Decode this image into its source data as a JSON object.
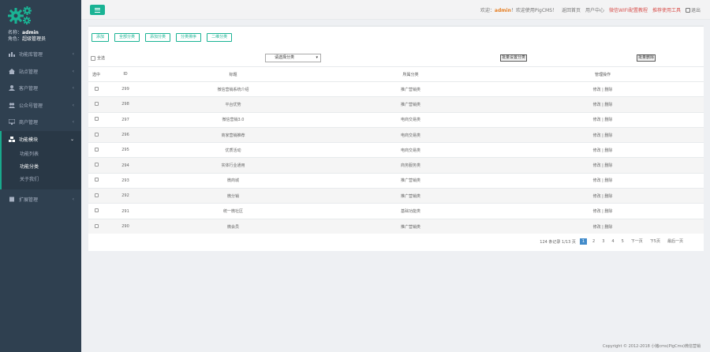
{
  "sidebar": {
    "name_label": "名称：",
    "name_value": "admin",
    "role_label": "角色：",
    "role_value": "超级管理员",
    "items": [
      {
        "label": "功能库管理",
        "active": false
      },
      {
        "label": "站点管理",
        "active": false
      },
      {
        "label": "客户管理",
        "active": false
      },
      {
        "label": "公众号管理",
        "active": false
      },
      {
        "label": "商户管理",
        "active": false
      },
      {
        "label": "功能模块",
        "active": true
      },
      {
        "label": "扩展管理",
        "active": false
      }
    ],
    "subitems": [
      {
        "label": "功能列表",
        "active": false
      },
      {
        "label": "功能分类",
        "active": true
      },
      {
        "label": "关于我们",
        "active": false
      }
    ]
  },
  "topbar": {
    "welcome_prefix": "欢迎",
    "user": "admin",
    "welcome_suffix": "！欢迎使用PigCMS！",
    "back_home": "返回首页",
    "user_center": "用户中心",
    "red_link1": "微信WIFI配置教程",
    "red_link2": "推荐使用工具",
    "logout": "退出"
  },
  "toolbar": [
    "添加",
    "全部分类",
    "添加分类",
    "分类排序",
    "二维分类"
  ],
  "filter": {
    "select_all": "全选",
    "select_value": "请选择分类",
    "btn_batch": "批量设置分类",
    "btn_delete": "批量删除"
  },
  "table": {
    "headers": [
      "选中",
      "ID",
      "标题",
      "所属分类",
      "管理操作"
    ],
    "rows": [
      {
        "id": "299",
        "title": "微信营销系统介绍",
        "cat": "推广营销类",
        "op": "修改 | 删除"
      },
      {
        "id": "298",
        "title": "平台优势",
        "cat": "推广营销类",
        "op": "修改 | 删除"
      },
      {
        "id": "297",
        "title": "微信营销3.0",
        "cat": "电商交易类",
        "op": "修改 | 删除"
      },
      {
        "id": "296",
        "title": "商家营销推荐",
        "cat": "电商交易类",
        "op": "修改 | 删除"
      },
      {
        "id": "295",
        "title": "优质活动",
        "cat": "电商交易类",
        "op": "修改 | 删除"
      },
      {
        "id": "294",
        "title": "实体行业通用",
        "cat": "商务服务类",
        "op": "修改 | 删除"
      },
      {
        "id": "293",
        "title": "微商城",
        "cat": "推广营销类",
        "op": "修改 | 删除"
      },
      {
        "id": "292",
        "title": "微分销",
        "cat": "推广营销类",
        "op": "修改 | 删除"
      },
      {
        "id": "291",
        "title": "统一微社区",
        "cat": "基础功能类",
        "op": "修改 | 删除"
      },
      {
        "id": "290",
        "title": "微会员",
        "cat": "推广营销类",
        "op": "修改 | 删除"
      }
    ]
  },
  "pager": {
    "summary": "124 条记录 1/13 页",
    "pages": [
      "1",
      "2",
      "3",
      "4",
      "5"
    ],
    "next": "下一页",
    "next5": "下5页",
    "last": "最后一页"
  },
  "footer": "Copyright © 2012-2018 小猪cms(PigCms)微信营销",
  "colors": {
    "accent": "#1ab394",
    "sidebar": "#2f4050",
    "red": "#d9534f",
    "user": "#e67e22"
  }
}
